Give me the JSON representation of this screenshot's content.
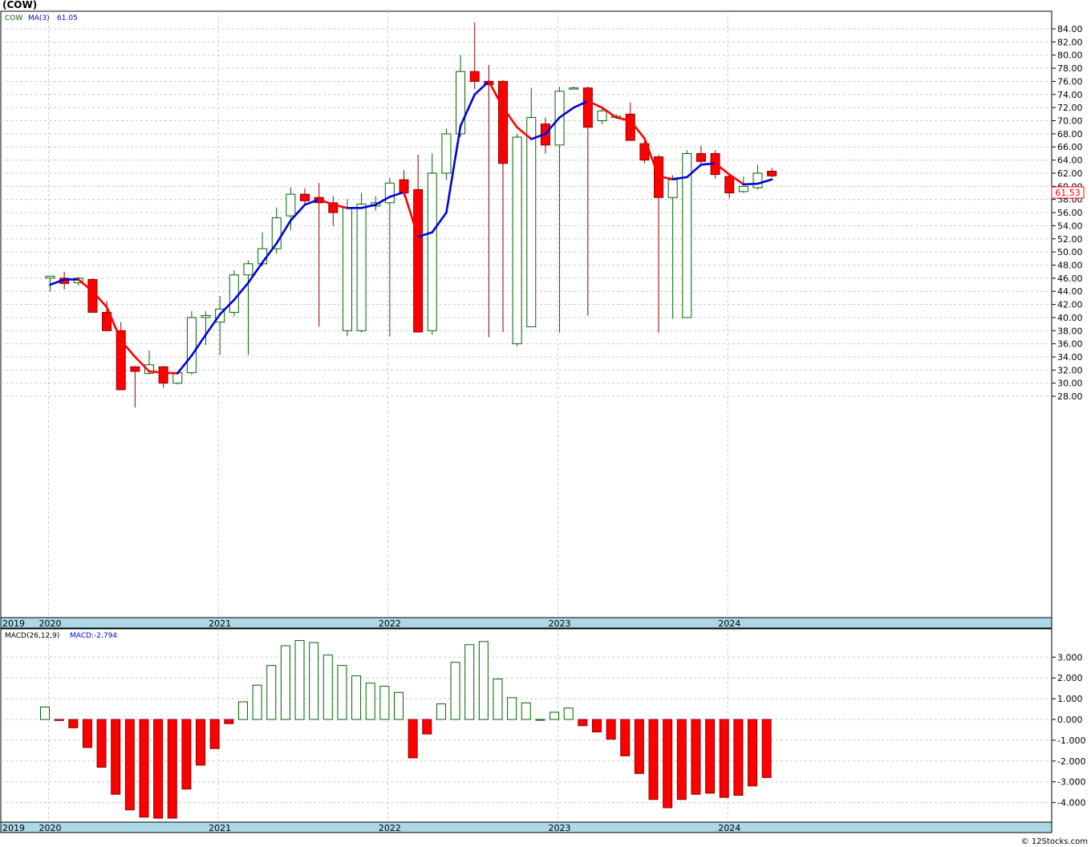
{
  "title": "(COW)",
  "legend": {
    "symbol": "COW",
    "ma_label": "MA(3)",
    "ma_value": "61.05"
  },
  "macd_legend": {
    "label": "MACD(26,12,9)",
    "value_label": "MACD:-2.794"
  },
  "last_price_label": "61.53",
  "watermark": "© 12Stocks.com",
  "colors": {
    "up": "#006400",
    "down": "#ff0000",
    "ma_up": "#0000dd",
    "ma_down": "#ff0000",
    "axis_band": "#add8e6",
    "grid": "#c8c8c8"
  },
  "chart_data": [
    {
      "type": "candlestick",
      "ylim": [
        26,
        86
      ],
      "yticks": [
        84,
        82,
        80,
        78,
        76,
        74,
        72,
        70,
        68,
        66,
        64,
        62,
        60,
        58,
        56,
        54,
        52,
        50,
        48,
        46,
        44,
        42,
        40,
        38,
        36,
        34,
        32,
        30,
        28
      ],
      "ytick_labels": [
        "84.00",
        "82.00",
        "80.00",
        "78.00",
        "76.00",
        "74.00",
        "72.00",
        "70.00",
        "68.00",
        "66.00",
        "64.00",
        "62.00",
        "60.00",
        "58.00",
        "56.00",
        "54.00",
        "52.00",
        "50.00",
        "48.00",
        "46.00",
        "44.00",
        "42.00",
        "40.00",
        "38.00",
        "36.00",
        "34.00",
        "32.00",
        "30.00",
        "28.00"
      ],
      "xlabels": [
        "2019",
        "2020",
        "2021",
        "2022",
        "2023",
        "2024"
      ],
      "xlabel_index": [
        -3.0,
        0.0,
        12.0,
        24.0,
        36.0,
        48.0
      ],
      "candles": [
        {
          "o": 46.0,
          "h": 46.3,
          "l": 44.0,
          "c": 46.3
        },
        {
          "o": 46.0,
          "h": 47.0,
          "l": 44.3,
          "c": 45.2
        },
        {
          "o": 45.3,
          "h": 46.2,
          "l": 44.9,
          "c": 46.0
        },
        {
          "o": 45.8,
          "h": 46.0,
          "l": 44.0,
          "c": 40.8
        },
        {
          "o": 40.8,
          "h": 42.5,
          "l": 37.9,
          "c": 38.0
        },
        {
          "o": 38.0,
          "h": 39.3,
          "l": 30.2,
          "c": 29.0
        },
        {
          "o": 32.5,
          "h": 32.6,
          "l": 26.3,
          "c": 31.8
        },
        {
          "o": 31.5,
          "h": 35.0,
          "l": 31.3,
          "c": 32.8
        },
        {
          "o": 32.5,
          "h": 32.6,
          "l": 29.3,
          "c": 30.0
        },
        {
          "o": 30.0,
          "h": 31.8,
          "l": 29.8,
          "c": 31.6
        },
        {
          "o": 31.6,
          "h": 41.0,
          "l": 31.3,
          "c": 40.0
        },
        {
          "o": 40.0,
          "h": 41.0,
          "l": 35.8,
          "c": 40.3
        },
        {
          "o": 39.3,
          "h": 43.3,
          "l": 34.3,
          "c": 41.3
        },
        {
          "o": 40.8,
          "h": 47.2,
          "l": 40.2,
          "c": 46.5
        },
        {
          "o": 46.5,
          "h": 48.7,
          "l": 34.3,
          "c": 48.2
        },
        {
          "o": 48.2,
          "h": 53.0,
          "l": 47.8,
          "c": 50.5
        },
        {
          "o": 50.5,
          "h": 56.8,
          "l": 49.8,
          "c": 55.2
        },
        {
          "o": 55.5,
          "h": 59.8,
          "l": 53.3,
          "c": 58.8
        },
        {
          "o": 58.8,
          "h": 59.7,
          "l": 57.3,
          "c": 57.8
        },
        {
          "o": 58.3,
          "h": 60.5,
          "l": 38.6,
          "c": 57.5
        },
        {
          "o": 57.5,
          "h": 58.5,
          "l": 54.0,
          "c": 56.0
        },
        {
          "o": 38.0,
          "h": 58.0,
          "l": 37.2,
          "c": 56.7
        },
        {
          "o": 38.0,
          "h": 59.0,
          "l": 37.7,
          "c": 57.3
        },
        {
          "o": 57.0,
          "h": 58.5,
          "l": 56.3,
          "c": 57.5
        },
        {
          "o": 57.5,
          "h": 61.3,
          "l": 37.1,
          "c": 60.5
        },
        {
          "o": 61.0,
          "h": 62.5,
          "l": 58.5,
          "c": 59.0
        },
        {
          "o": 59.5,
          "h": 64.8,
          "l": 37.7,
          "c": 37.8
        },
        {
          "o": 38.0,
          "h": 65.0,
          "l": 37.4,
          "c": 62.0
        },
        {
          "o": 62.0,
          "h": 68.8,
          "l": 61.0,
          "c": 68.0
        },
        {
          "o": 68.0,
          "h": 80.0,
          "l": 67.5,
          "c": 77.5
        },
        {
          "o": 77.5,
          "h": 85.0,
          "l": 74.8,
          "c": 76.0
        },
        {
          "o": 76.0,
          "h": 78.5,
          "l": 37.0,
          "c": 75.5
        },
        {
          "o": 76.0,
          "h": 76.2,
          "l": 37.8,
          "c": 63.5
        },
        {
          "o": 36.0,
          "h": 68.0,
          "l": 35.6,
          "c": 67.5
        },
        {
          "o": 38.6,
          "h": 75.0,
          "l": 38.6,
          "c": 70.5
        },
        {
          "o": 69.5,
          "h": 70.5,
          "l": 65.0,
          "c": 66.3
        },
        {
          "o": 66.3,
          "h": 75.2,
          "l": 37.7,
          "c": 74.5
        },
        {
          "o": 75.0,
          "h": 75.2,
          "l": 74.9,
          "c": 75.0
        },
        {
          "o": 75.0,
          "h": 75.2,
          "l": 40.3,
          "c": 69.0
        },
        {
          "o": 70.0,
          "h": 72.0,
          "l": 69.5,
          "c": 71.5
        },
        {
          "o": 70.5,
          "h": 71.0,
          "l": 70.3,
          "c": 70.7
        },
        {
          "o": 71.0,
          "h": 72.8,
          "l": 67.5,
          "c": 67.0
        },
        {
          "o": 66.5,
          "h": 67.0,
          "l": 63.5,
          "c": 64.0
        },
        {
          "o": 64.5,
          "h": 64.8,
          "l": 37.7,
          "c": 58.3
        },
        {
          "o": 58.3,
          "h": 61.7,
          "l": 39.8,
          "c": 61.0
        },
        {
          "o": 40.0,
          "h": 65.5,
          "l": 40.0,
          "c": 65.0
        },
        {
          "o": 65.0,
          "h": 66.2,
          "l": 63.5,
          "c": 63.8
        },
        {
          "o": 65.0,
          "h": 65.5,
          "l": 61.2,
          "c": 61.8
        },
        {
          "o": 61.5,
          "h": 62.0,
          "l": 58.2,
          "c": 59.0
        },
        {
          "o": 59.2,
          "h": 61.5,
          "l": 59.0,
          "c": 60.0
        },
        {
          "o": 59.8,
          "h": 63.3,
          "l": 59.5,
          "c": 62.0
        },
        {
          "o": 62.3,
          "h": 62.8,
          "l": 61.4,
          "c": 61.6
        }
      ],
      "ma3": [
        45.0,
        45.8,
        45.8,
        44.0,
        41.6,
        36.5,
        34.0,
        31.8,
        31.6,
        31.5,
        34.2,
        37.4,
        40.5,
        42.7,
        45.3,
        48.4,
        51.3,
        54.8,
        57.2,
        58.0,
        57.2,
        56.7,
        56.7,
        57.2,
        58.4,
        59.1,
        52.3,
        53.0,
        56.0,
        69.2,
        74.0,
        76.0,
        72.0,
        69.0,
        67.2,
        68.0,
        70.5,
        72.0,
        73.0,
        72.0,
        70.5,
        70.0,
        67.3,
        61.5,
        61.1,
        61.4,
        63.3,
        63.5,
        61.8,
        60.3,
        60.4,
        61.05
      ]
    },
    {
      "type": "bar",
      "series": [
        {
          "name": "MACD(26,12,9)",
          "values": [
            0.6,
            -0.05,
            -0.4,
            -1.35,
            -2.3,
            -3.6,
            -4.35,
            -4.7,
            -4.75,
            -4.75,
            -3.35,
            -2.2,
            -1.4,
            -0.2,
            0.85,
            1.65,
            2.6,
            3.55,
            3.8,
            3.7,
            3.1,
            2.6,
            2.1,
            1.75,
            1.6,
            1.3,
            -1.85,
            -0.7,
            0.75,
            2.75,
            3.6,
            3.75,
            1.95,
            1.05,
            0.8,
            0.0,
            0.35,
            0.55,
            -0.3,
            -0.6,
            -0.95,
            -1.75,
            -2.6,
            -3.85,
            -4.25,
            -3.85,
            -3.6,
            -3.55,
            -3.75,
            -3.65,
            -3.2,
            -2.794
          ]
        }
      ],
      "ylim": [
        -5.0,
        4.0
      ],
      "yticks": [
        3,
        2,
        1,
        0,
        -1,
        -2,
        -3,
        -4
      ],
      "ytick_labels": [
        "3.000",
        "2.000",
        "1.000",
        "0.000",
        "-1.000",
        "-2.000",
        "-3.000",
        "-4.000"
      ],
      "xlabels": [
        "2019",
        "2020",
        "2021",
        "2022",
        "2023",
        "2024"
      ],
      "xlabel_index": [
        -3.0,
        0.0,
        12.0,
        24.0,
        36.0,
        48.0
      ]
    }
  ]
}
